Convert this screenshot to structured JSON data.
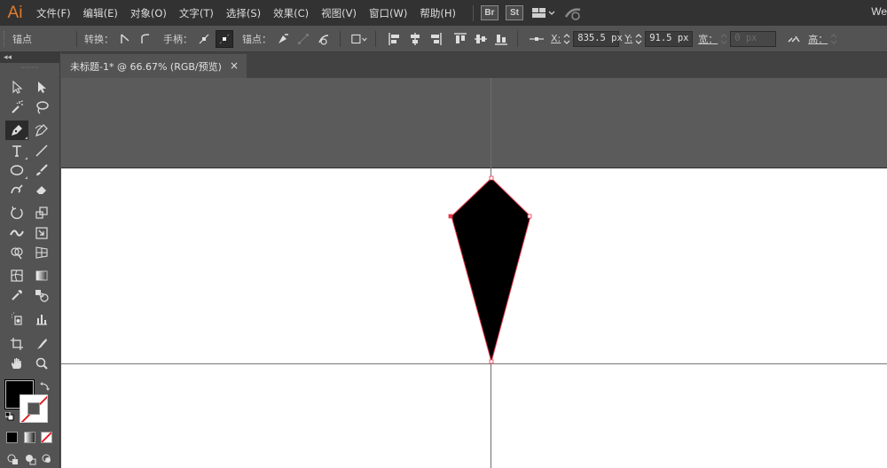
{
  "app": {
    "logo": "Ai",
    "workspace": "We"
  },
  "menu": {
    "items": [
      "文件(F)",
      "编辑(E)",
      "对象(O)",
      "文字(T)",
      "选择(S)",
      "效果(C)",
      "视图(V)",
      "窗口(W)",
      "帮助(H)"
    ],
    "bridge_label": "Br",
    "stock_label": "St"
  },
  "controlbar": {
    "anchor_label": "锚点",
    "convert_label": "转换：",
    "handles_label": "手柄：",
    "anchors_label": "锚点：",
    "x_label": "X:",
    "x_value": "835.5 px",
    "y_label": "Y:",
    "y_value": "91.5 px",
    "width_label": "宽：",
    "width_value": "0 px",
    "height_label": "高："
  },
  "toolbox": {
    "collapse_glyph": "◂◂"
  },
  "document": {
    "tab_title": "未标题-1* @ 66.67% (RGB/预览)",
    "close_glyph": "×"
  },
  "colors": {
    "fill": "#000000",
    "stroke": "none",
    "path_highlight": "#e8374a",
    "accent": "#e37b2a"
  }
}
